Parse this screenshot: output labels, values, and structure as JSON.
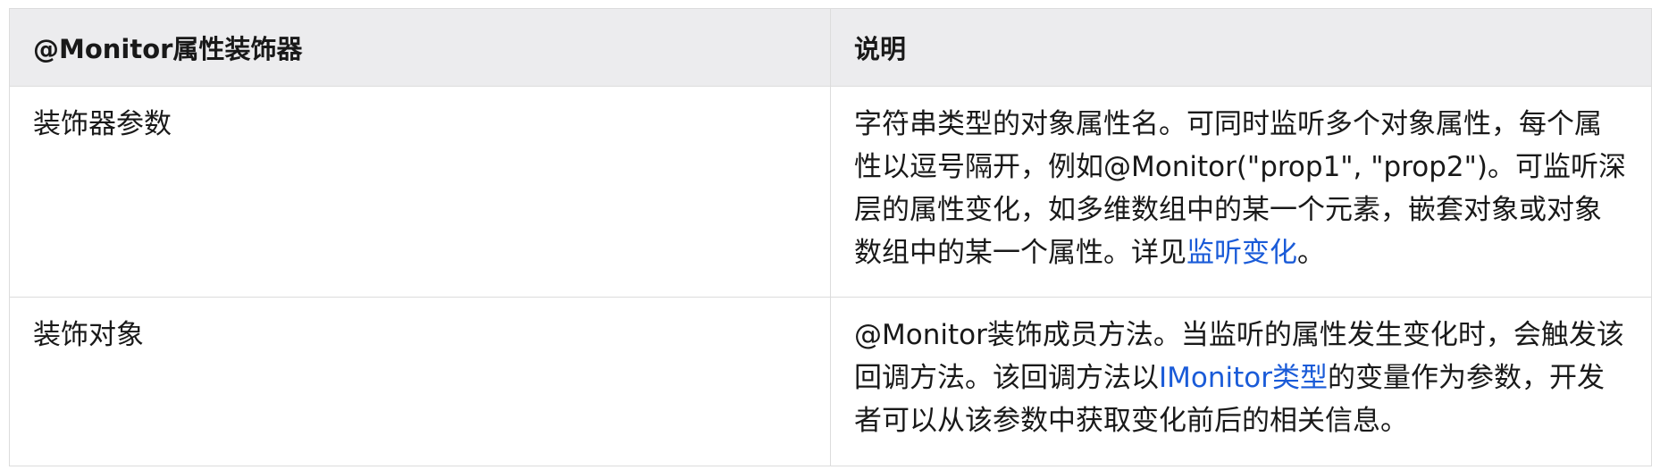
{
  "table": {
    "headers": [
      "@Monitor属性装饰器",
      "说明"
    ],
    "rows": [
      {
        "label": "装饰器参数",
        "desc_before": "字符串类型的对象属性名。可同时监听多个对象属性，每个属性以逗号隔开，例如@Monitor(\"prop1\", \"prop2\")。可监听深层的属性变化，如多维数组中的某一个元素，嵌套对象或对象数组中的某一个属性。详见",
        "link": "监听变化",
        "desc_after": "。"
      },
      {
        "label": "装饰对象",
        "desc_before": "@Monitor装饰成员方法。当监听的属性发生变化时，会触发该回调方法。该回调方法以",
        "link": "IMonitor类型",
        "desc_after": "的变量作为参数，开发者可以从该参数中获取变化前后的相关信息。"
      }
    ]
  },
  "colors": {
    "header_bg": "#ececee",
    "border": "#dcdcdc",
    "text": "#191919",
    "link": "#1a5bd8"
  }
}
